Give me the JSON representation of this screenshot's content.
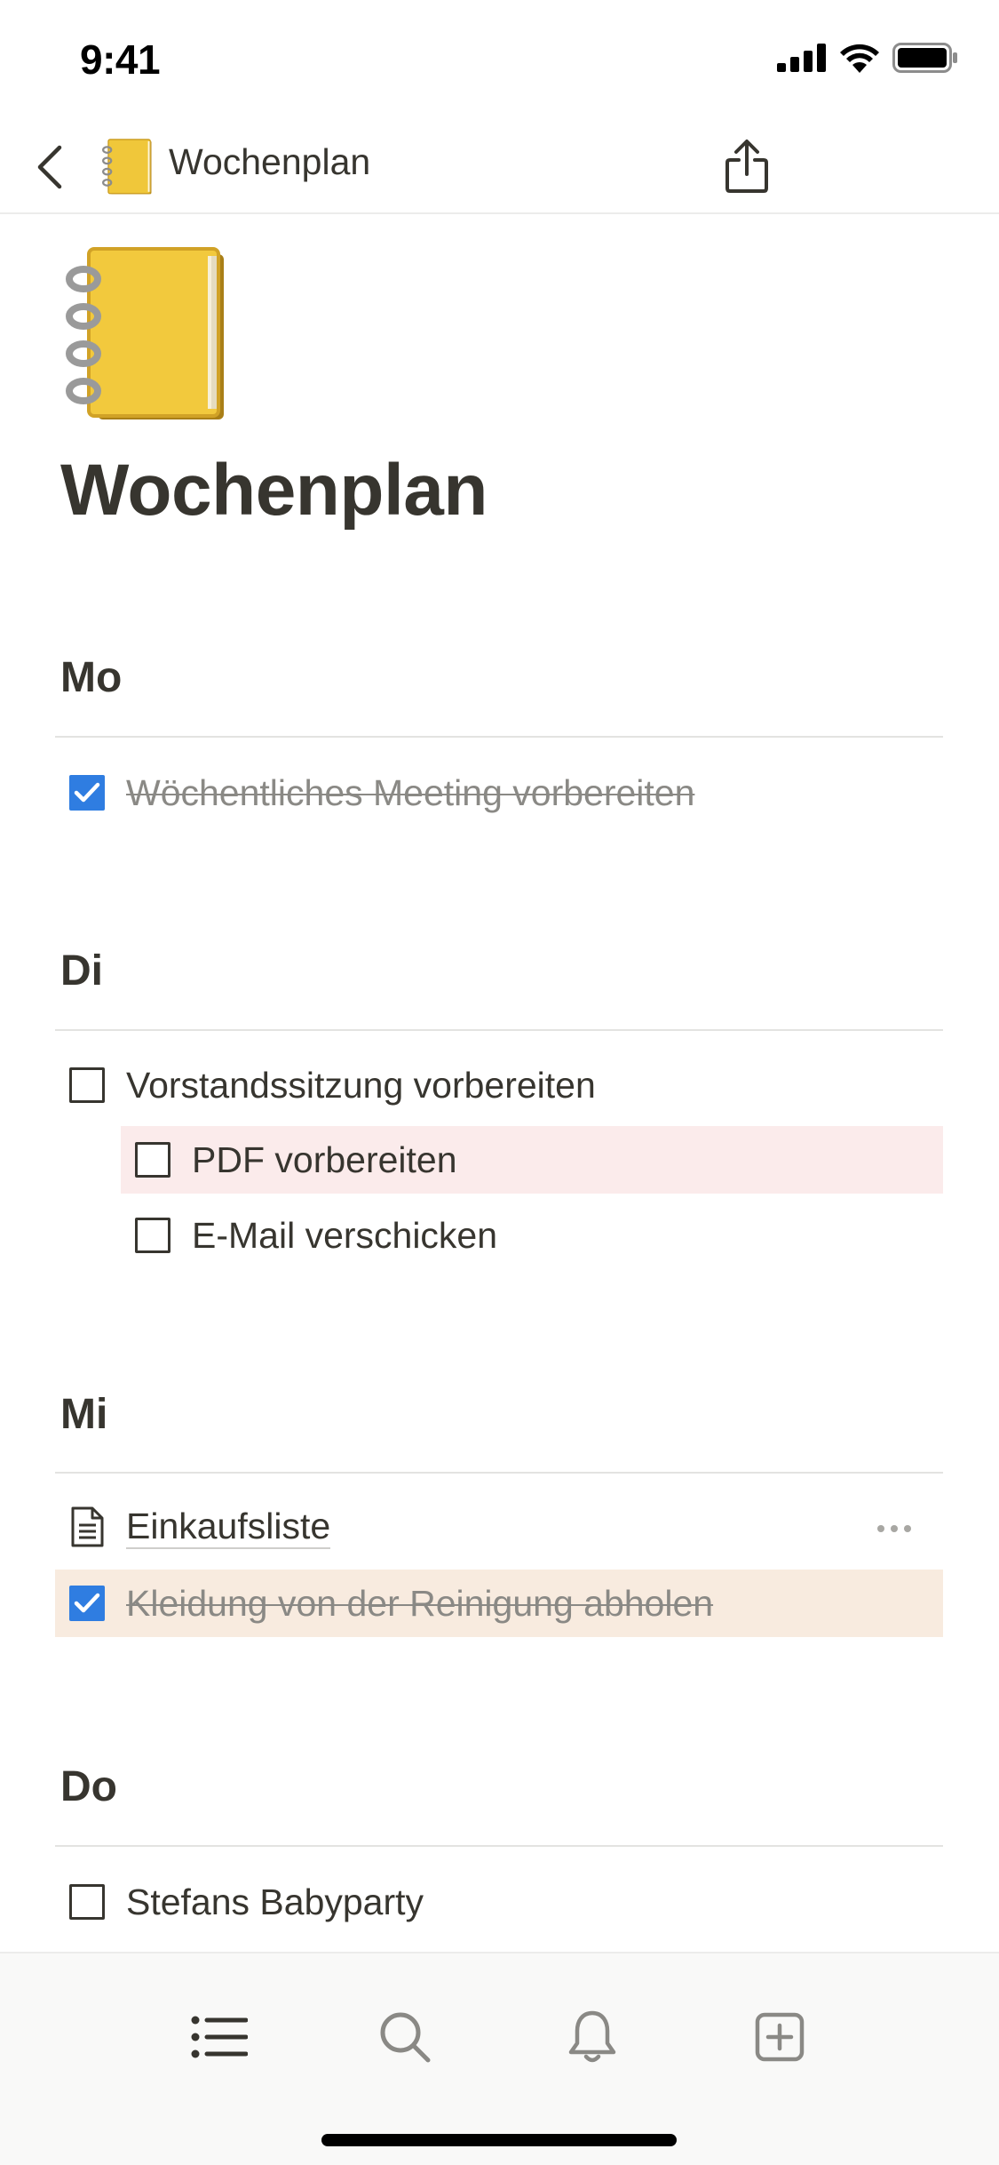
{
  "status_bar": {
    "time": "9:41"
  },
  "nav": {
    "title": "Wochenplan"
  },
  "page": {
    "title": "Wochenplan"
  },
  "sections": {
    "mo": {
      "heading": "Mo",
      "items": [
        {
          "label": "Wöchentliches Meeting vorbereiten",
          "checked": true
        }
      ]
    },
    "di": {
      "heading": "Di",
      "items": [
        {
          "label": "Vorstandssitzung vorbereiten",
          "checked": false
        },
        {
          "label": "PDF vorbereiten",
          "checked": false,
          "indent": 1,
          "highlight": "pink"
        },
        {
          "label": "E-Mail verschicken",
          "checked": false,
          "indent": 1
        }
      ]
    },
    "mi": {
      "heading": "Mi",
      "page_link": {
        "label": "Einkaufsliste"
      },
      "items": [
        {
          "label": "Kleidung von der Reinigung abholen",
          "checked": true,
          "highlight": "peach"
        }
      ]
    },
    "do": {
      "heading": "Do",
      "items": [
        {
          "label": "Stefans Babyparty",
          "checked": false
        }
      ]
    }
  },
  "icons": {
    "back": "chevron-left-icon",
    "share": "share-icon",
    "page_icon": "spiral-notebook-emoji",
    "tabs": [
      "list-icon",
      "search-icon",
      "bell-icon",
      "plus-square-icon"
    ]
  },
  "colors": {
    "accent": "#2f7de1",
    "text": "#37352f",
    "highlight_pink": "#fbebeb",
    "highlight_peach": "#f8ebdf"
  }
}
